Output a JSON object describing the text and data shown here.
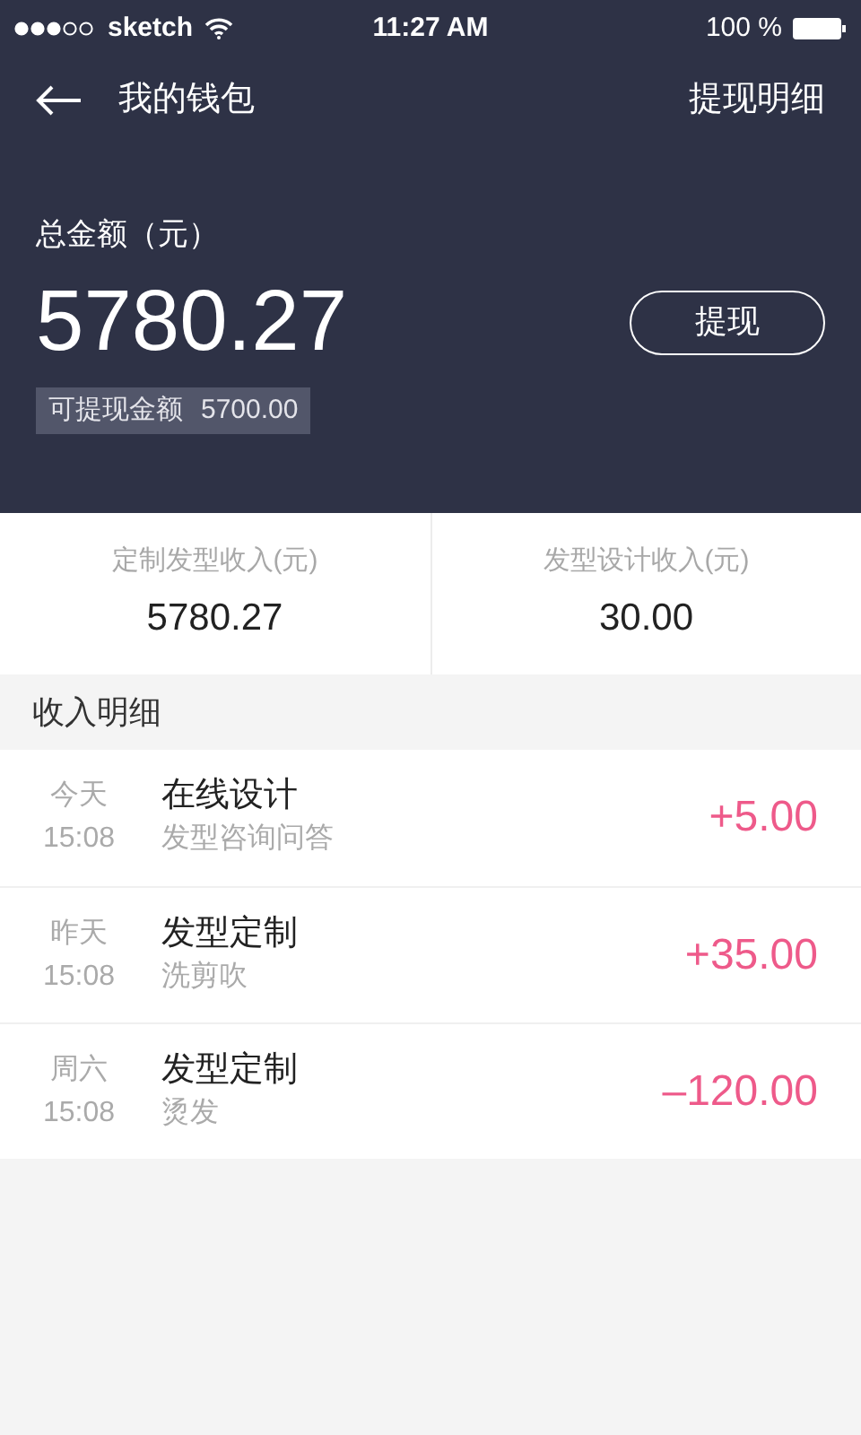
{
  "status_bar": {
    "carrier": "sketch",
    "time": "11:27 AM",
    "battery": "100 %"
  },
  "nav": {
    "title": "我的钱包",
    "action": "提现明细"
  },
  "balance": {
    "label": "总金额（元）",
    "amount": "5780.27",
    "withdrawable_label": "可提现金额",
    "withdrawable_amount": "5700.00",
    "button": "提现"
  },
  "stats": [
    {
      "label": "定制发型收入(元)",
      "value": "5780.27"
    },
    {
      "label": "发型设计收入(元)",
      "value": "30.00"
    }
  ],
  "section_title": "收入明细",
  "records": [
    {
      "day": "今天",
      "time": "15:08",
      "title": "在线设计",
      "subtitle": "发型咨询问答",
      "amount": "+5.00"
    },
    {
      "day": "昨天",
      "time": "15:08",
      "title": "发型定制",
      "subtitle": "洗剪吹",
      "amount": "+35.00"
    },
    {
      "day": "周六",
      "time": "15:08",
      "title": "发型定制",
      "subtitle": "烫发",
      "amount": "–120.00"
    }
  ]
}
